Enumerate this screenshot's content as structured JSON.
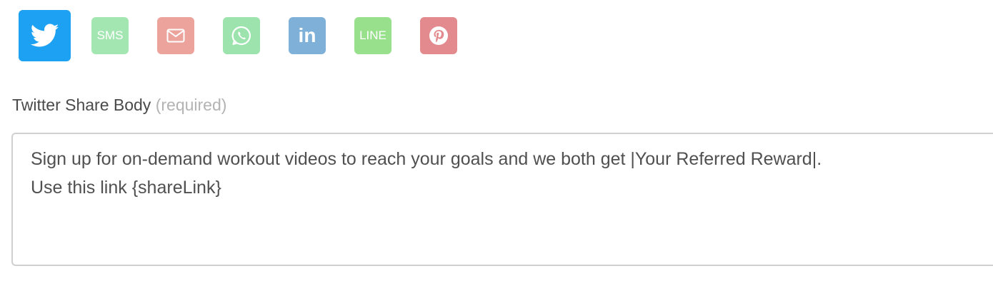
{
  "share_buttons": [
    {
      "name": "Twitter",
      "icon": "twitter-icon",
      "color": "#1DA1F2",
      "active": true
    },
    {
      "name": "SMS",
      "label": "SMS",
      "icon": "sms-icon",
      "color": "#A4E6B2",
      "active": false
    },
    {
      "name": "Email",
      "icon": "envelope-icon",
      "color": "#EBA39B",
      "active": false
    },
    {
      "name": "WhatsApp",
      "icon": "whatsapp-icon",
      "color": "#9CE3AD",
      "active": false
    },
    {
      "name": "LinkedIn",
      "label": "in",
      "icon": "linkedin-icon",
      "color": "#7FB0D8",
      "active": false
    },
    {
      "name": "LINE",
      "label": "LINE",
      "icon": "line-icon",
      "color": "#98E08C",
      "active": false
    },
    {
      "name": "Pinterest",
      "icon": "pinterest-icon",
      "color": "#E38A8E",
      "active": false
    }
  ],
  "field": {
    "label": "Twitter Share Body",
    "required_note": "(required)",
    "value_line1": "Sign up for on-demand workout videos to reach your goals and we both get |Your Referred Reward|.",
    "value_line2": "Use this link {shareLink}"
  }
}
